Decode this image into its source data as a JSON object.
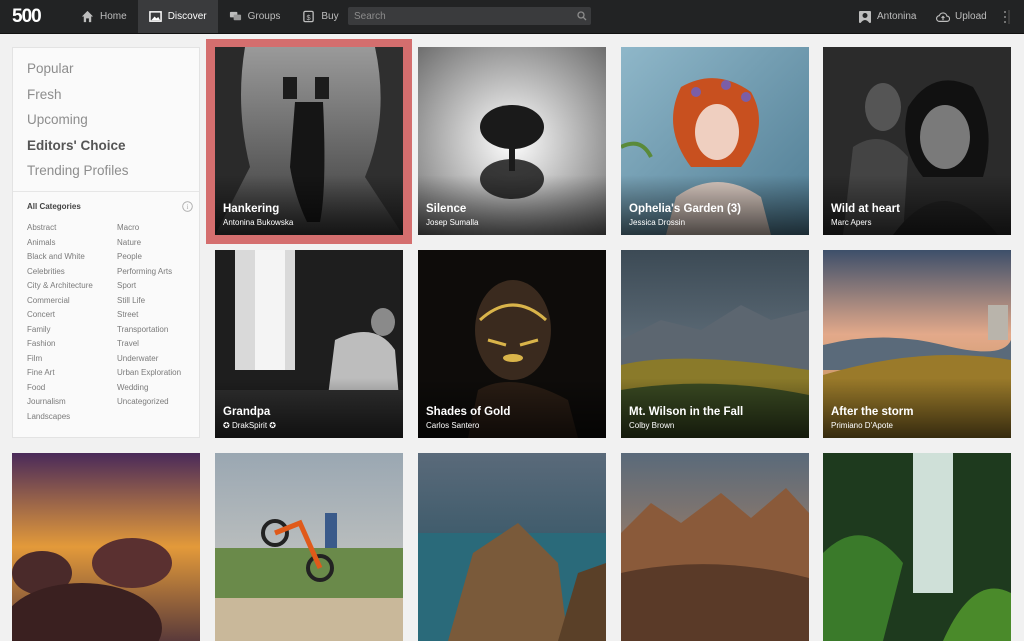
{
  "app": {
    "logo": "500"
  },
  "nav": {
    "items": [
      {
        "label": "Home",
        "icon": "home-icon"
      },
      {
        "label": "Discover",
        "icon": "picture-icon",
        "active": true
      },
      {
        "label": "Groups",
        "icon": "chat-icon"
      },
      {
        "label": "Buy",
        "icon": "dollar-tag-icon"
      }
    ]
  },
  "search": {
    "placeholder": "Search",
    "value": ""
  },
  "user": {
    "name": "Antonina",
    "icon": "user-icon"
  },
  "upload": {
    "label": "Upload",
    "icon": "cloud-upload-icon"
  },
  "sidebar": {
    "filters": [
      "Popular",
      "Fresh",
      "Upcoming",
      "Editors' Choice",
      "Trending Profiles"
    ],
    "selected_filter": "Editors' Choice",
    "categories_title": "All Categories",
    "categories_col1": [
      "Abstract",
      "Animals",
      "Black and White",
      "Celebrities",
      "City & Architecture",
      "Commercial",
      "Concert",
      "Family",
      "Fashion",
      "Film",
      "Fine Art",
      "Food",
      "Journalism",
      "Landscapes"
    ],
    "categories_col2": [
      "Macro",
      "Nature",
      "People",
      "Performing Arts",
      "Sport",
      "Still Life",
      "Street",
      "Transportation",
      "Travel",
      "Underwater",
      "Urban Exploration",
      "Wedding",
      "Uncategorized"
    ]
  },
  "photos": [
    {
      "title": "Hankering",
      "author": "Antonina Bukowska",
      "selected": true
    },
    {
      "title": "Silence",
      "author": "Josep Sumalla"
    },
    {
      "title": "Ophelia's Garden (3)",
      "author": "Jessica Drossin"
    },
    {
      "title": "Wild at heart",
      "author": "Marc Apers"
    },
    {
      "title": "Grandpa",
      "author": "DrakSpirit"
    },
    {
      "title": "Shades of Gold",
      "author": "Carlos Santero"
    },
    {
      "title": "Mt. Wilson in the Fall",
      "author": "Colby Brown"
    },
    {
      "title": "After the storm",
      "author": "Primiano D'Apote"
    },
    {
      "title": "",
      "author": ""
    },
    {
      "title": "",
      "author": ""
    },
    {
      "title": "",
      "author": ""
    },
    {
      "title": "",
      "author": ""
    },
    {
      "title": "",
      "author": ""
    }
  ],
  "colors": {
    "topbar": "#222324",
    "highlight": "#d46e6e"
  }
}
